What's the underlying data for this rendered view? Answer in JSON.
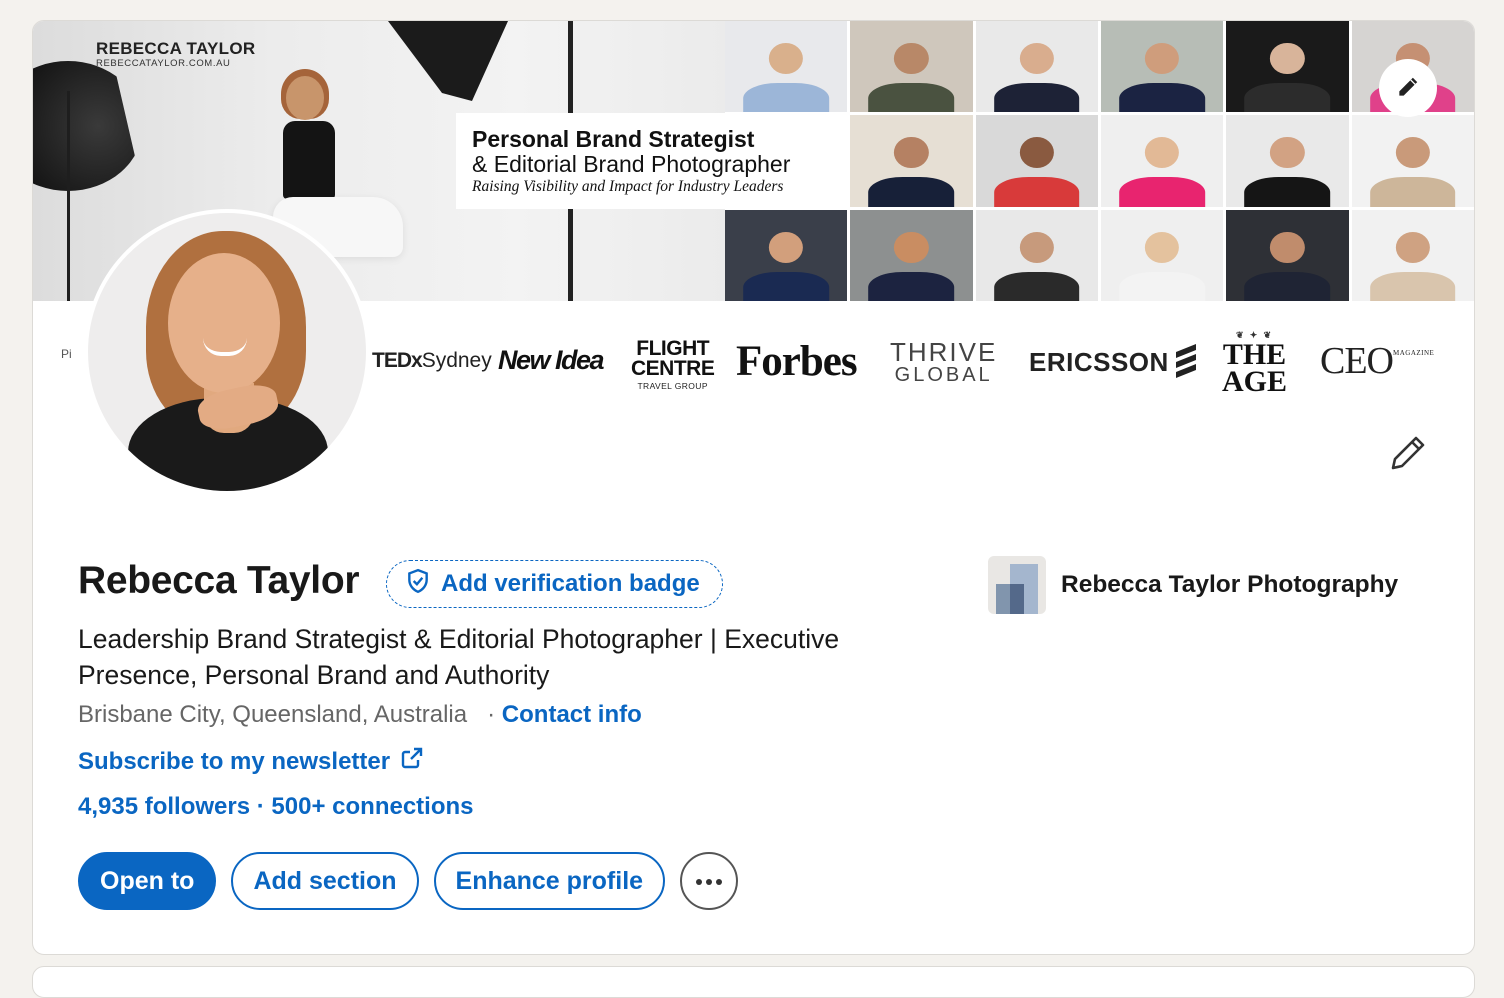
{
  "banner": {
    "brand_name": "REBECCA TAYLOR",
    "brand_url": "REBECCATAYLOR.COM.AU",
    "tagline_line1": "Personal Brand Strategist",
    "tagline_line2": "& Editorial Brand Photographer",
    "tagline_line3": "Raising Visibility and Impact for Industry Leaders",
    "edit_icon": "pencil-icon",
    "truncated_label": "Pi",
    "logos": {
      "tedx": "TEDx",
      "tedx_city": "Sydney",
      "new_idea": "New Idea",
      "flight_centre_line1": "FLIGHT",
      "flight_centre_line2": "CENTRE",
      "flight_centre_line3": "TRAVEL GROUP",
      "forbes": "Forbes",
      "thrive_line1": "THRIVE",
      "thrive_line2": "GLOBAL",
      "ericsson": "ERICSSON",
      "the_age_line1": "THE",
      "the_age_line2": "AGE",
      "ceo": "CEO",
      "ceo_suffix": "MAGAZINE"
    }
  },
  "profile": {
    "name": "Rebecca Taylor",
    "verification_label": "Add verification badge",
    "verification_icon": "shield-check-icon",
    "headline": "Leadership Brand Strategist & Editorial Photographer | Executive Presence, Personal Brand and Authority",
    "location": "Brisbane City, Queensland, Australia",
    "separator": "·",
    "contact_info": "Contact info",
    "newsletter": "Subscribe to my newsletter",
    "newsletter_icon": "external-link-icon",
    "followers": "4,935 followers",
    "stats_separator": "·",
    "connections": "500+ connections",
    "edit_icon": "pencil-icon"
  },
  "company": {
    "name": "Rebecca Taylor Photography"
  },
  "actions": {
    "open_to": "Open to",
    "add_section": "Add section",
    "enhance_profile": "Enhance profile",
    "more_icon": "ellipsis-icon"
  },
  "colors": {
    "accent": "#0a66c2",
    "page_background": "#f4f2ee",
    "card_background": "#ffffff",
    "text_primary": "#191919",
    "text_secondary": "#666666"
  }
}
